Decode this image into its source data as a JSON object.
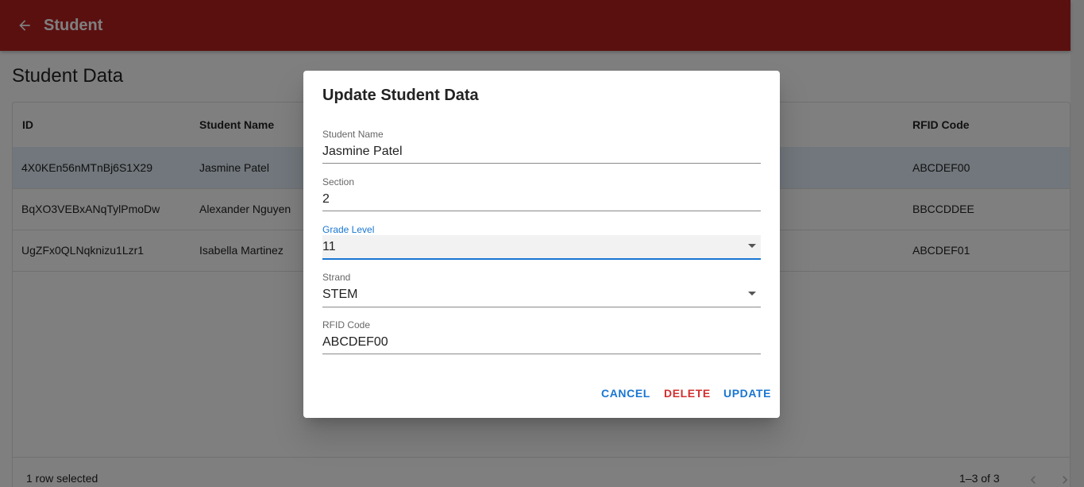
{
  "appbar": {
    "title": "Student",
    "back_icon": "arrow-left-icon",
    "color": "#b72121"
  },
  "page": {
    "title": "Student Data"
  },
  "table": {
    "columns": [
      "ID",
      "Student Name",
      "RFID Code"
    ],
    "rows": [
      {
        "id": "4X0KEn56nMTnBj6S1X29",
        "name": "Jasmine Patel",
        "rfid": "ABCDEF00",
        "selected": true
      },
      {
        "id": "BqXO3VEBxANqTylPmoDw",
        "name": "Alexander Nguyen",
        "rfid": "BBCCDDEE",
        "selected": false
      },
      {
        "id": "UgZFx0QLNqknizu1Lzr1",
        "name": "Isabella Martinez",
        "rfid": "ABCDEF01",
        "selected": false
      }
    ],
    "footer": {
      "selected_text": "1 row selected",
      "range_text": "1–3 of 3"
    }
  },
  "dialog": {
    "title": "Update Student Data",
    "fields": {
      "student_name": {
        "label": "Student Name",
        "value": "Jasmine Patel"
      },
      "section": {
        "label": "Section",
        "value": "2"
      },
      "grade_level": {
        "label": "Grade Level",
        "value": "11"
      },
      "strand": {
        "label": "Strand",
        "value": "STEM"
      },
      "rfid_code": {
        "label": "RFID Code",
        "value": "ABCDEF00"
      }
    },
    "buttons": {
      "cancel": "CANCEL",
      "delete": "DELETE",
      "update": "UPDATE"
    },
    "colors": {
      "primary": "#1976d2",
      "danger": "#d32f2f"
    }
  }
}
